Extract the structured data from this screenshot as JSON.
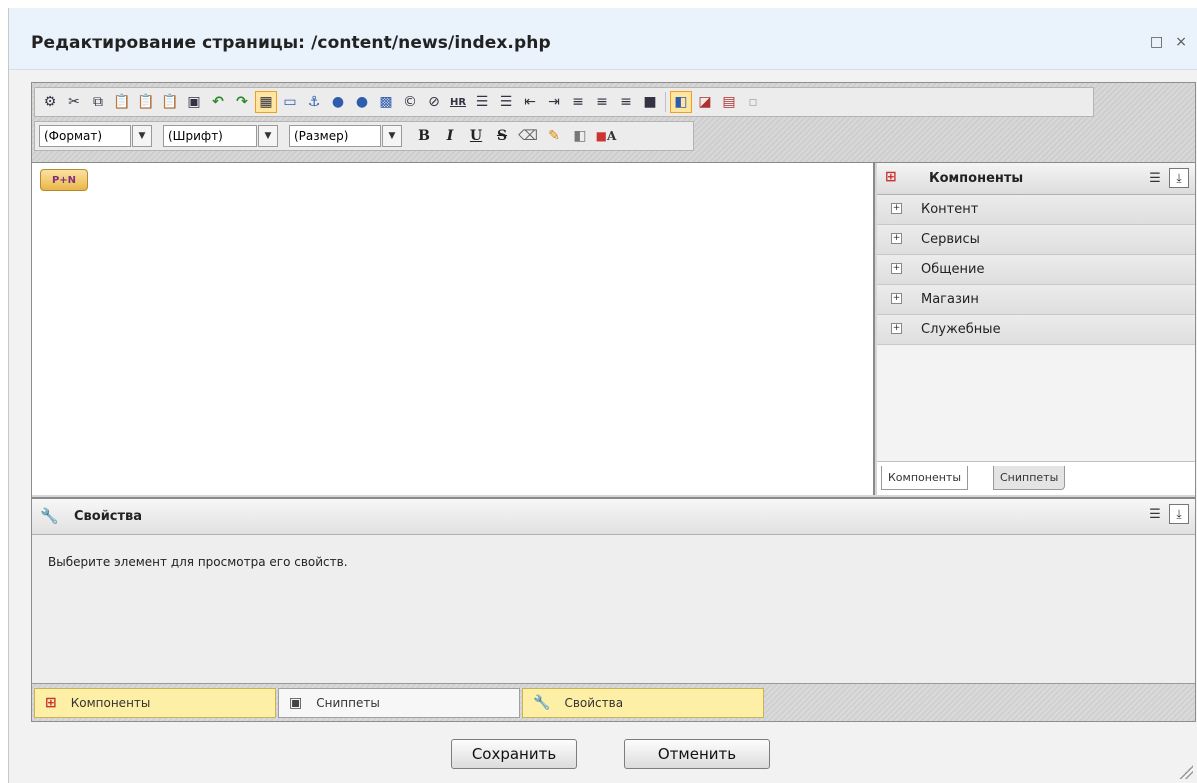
{
  "dialog": {
    "title": "Редактирование страницы: /content/news/index.php",
    "restore_glyph": "□",
    "close_glyph": "×"
  },
  "toolbar": {
    "row1_icons": [
      "settings-icon",
      "cut-icon",
      "copy-icon",
      "paste-icon",
      "paste-word-icon",
      "paste-text-icon",
      "source-icon",
      "undo-icon",
      "redo-icon",
      "table-icon",
      "frame-icon",
      "anchor-icon",
      "link-icon",
      "unlink-icon",
      "image-icon",
      "copyright-icon",
      "special-char-icon",
      "horizontal-rule-icon",
      "ordered-list-icon",
      "unordered-list-icon",
      "outdent-icon",
      "indent-icon",
      "align-left-icon",
      "align-center-icon",
      "align-right-icon",
      "justify-icon",
      "view-split-icon",
      "view-code-icon",
      "view-both-icon",
      "fullscreen-icon"
    ],
    "hr_label": "HR",
    "format_select": "(Формат)",
    "font_select": "(Шрифт)",
    "size_select": "(Размер)",
    "bold_label": "B",
    "italic_label": "I",
    "underline_label": "U",
    "strike_label": "S",
    "color_label": "A"
  },
  "components_panel": {
    "title": "Компоненты",
    "items": [
      {
        "label": "Контент"
      },
      {
        "label": "Сервисы"
      },
      {
        "label": "Общение"
      },
      {
        "label": "Магазин"
      },
      {
        "label": "Служебные"
      }
    ],
    "tabs": [
      {
        "label": "Компоненты"
      },
      {
        "label": "Сниппеты"
      }
    ]
  },
  "properties_panel": {
    "title": "Свойства",
    "hint": "Выберите элемент для просмотра его свойств."
  },
  "bottom_tabs": [
    {
      "label": "Компоненты"
    },
    {
      "label": "Сниппеты"
    },
    {
      "label": "Свойства"
    }
  ],
  "footer": {
    "save_label": "Сохранить",
    "cancel_label": "Отменить"
  },
  "colors": {
    "titlebar": "#eaf2fb",
    "active_tab": "#fdf0a6",
    "active_button": "#ffe6a0"
  }
}
